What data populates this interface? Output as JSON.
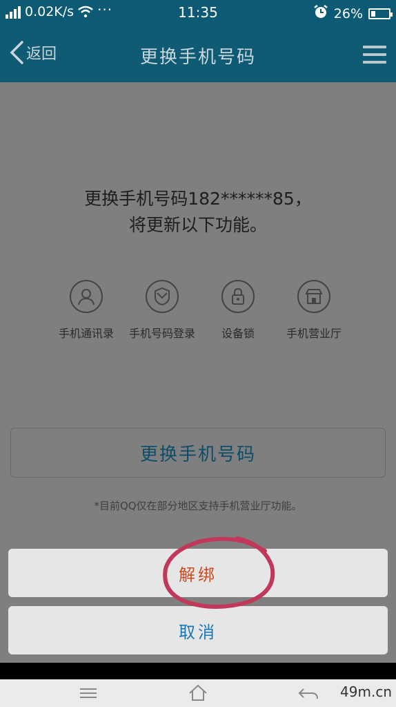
{
  "status_bar": {
    "network_speed": "0.02K/s",
    "more": "···",
    "time": "11:35",
    "battery": "26%",
    "battery_level": 0.26
  },
  "nav": {
    "back_label": "返回",
    "title": "更换手机号码"
  },
  "main": {
    "info_line1": "更换手机号码182******85，",
    "info_line2": "将更新以下功能。",
    "features": [
      {
        "label": "手机通讯录",
        "icon": "contact-icon"
      },
      {
        "label": "手机号码登录",
        "icon": "shield-icon"
      },
      {
        "label": "设备锁",
        "icon": "lock-icon"
      },
      {
        "label": "手机营业厅",
        "icon": "store-icon"
      }
    ],
    "change_button": "更换手机号码",
    "note": "*目前QQ仅在部分地区支持手机营业厅功能。"
  },
  "action_sheet": {
    "unbind_label": "解绑",
    "cancel_label": "取消",
    "unbind_color": "#d04a1f",
    "cancel_color": "#1b78b6"
  },
  "system_nav": {
    "items": [
      "menu-icon",
      "home-icon",
      "back-icon"
    ],
    "watermark": "49m.cn"
  },
  "colors": {
    "header": "#0f5b73",
    "overlay": "#7f7f7f"
  }
}
